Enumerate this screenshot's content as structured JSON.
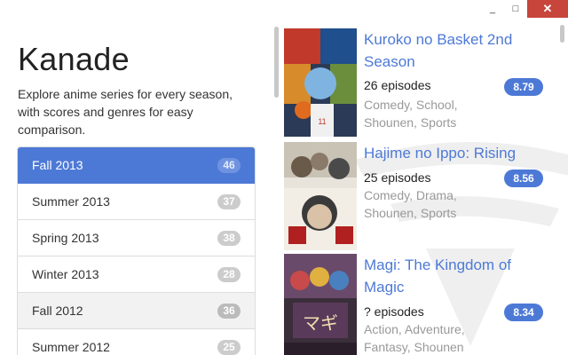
{
  "window": {
    "minimize": "_",
    "maximize": "□",
    "close": "✕"
  },
  "app": {
    "title": "Kanade",
    "description": "Explore anime series for every season, with scores and genres for easy comparison."
  },
  "seasons": [
    {
      "label": "Fall 2013",
      "count": "46"
    },
    {
      "label": "Summer 2013",
      "count": "37"
    },
    {
      "label": "Spring 2013",
      "count": "38"
    },
    {
      "label": "Winter 2013",
      "count": "28"
    },
    {
      "label": "Fall 2012",
      "count": "36"
    },
    {
      "label": "Summer 2012",
      "count": "25"
    }
  ],
  "anime": [
    {
      "title": "Kuroko no Basket 2nd Season",
      "episodes": "26 episodes",
      "genres": "Comedy, School, Shounen, Sports",
      "score": "8.79"
    },
    {
      "title": "Hajime no Ippo: Rising",
      "episodes": "25 episodes",
      "genres": "Comedy, Drama, Shounen, Sports",
      "score": "8.56"
    },
    {
      "title": "Magi: The Kingdom of Magic",
      "episodes": "? episodes",
      "genres": "Action, Adventure, Fantasy, Shounen",
      "score": "8.34"
    }
  ],
  "colors": {
    "accent": "#4d79d6",
    "close": "#c7453a",
    "badge": "#cccccc"
  }
}
